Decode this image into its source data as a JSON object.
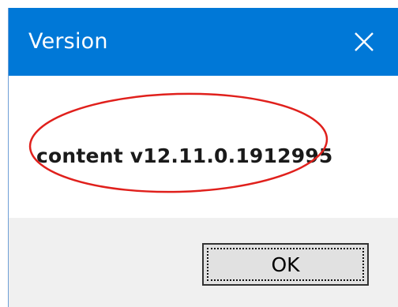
{
  "dialog": {
    "title": "Version",
    "close_icon": "close-icon",
    "message": "content v12.11.0.1912995",
    "ok_label": "OK"
  },
  "colors": {
    "titlebar": "#0078d7",
    "annotation": "#e0201c"
  }
}
